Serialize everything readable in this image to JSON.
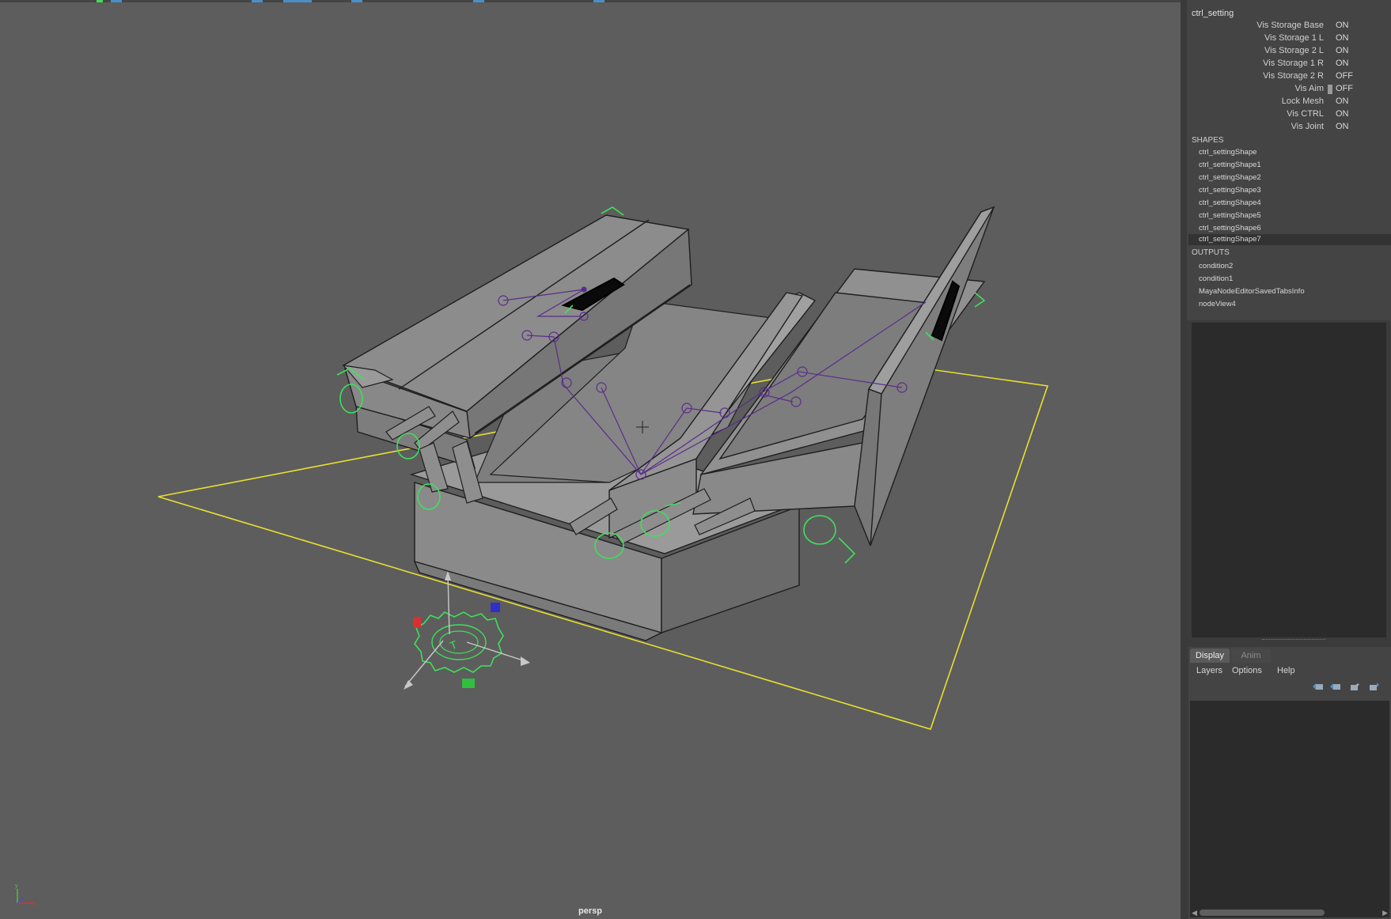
{
  "viewport": {
    "camera_label": "persp"
  },
  "channel_box": {
    "node_name": "ctrl_setting",
    "attributes": [
      {
        "label": "Vis Storage Base",
        "value": "ON"
      },
      {
        "label": "Vis Storage 1 L",
        "value": "ON"
      },
      {
        "label": "Vis Storage 2 L",
        "value": "ON"
      },
      {
        "label": "Vis Storage 1 R",
        "value": "ON"
      },
      {
        "label": "Vis Storage 2 R",
        "value": "OFF"
      },
      {
        "label": "Vis Aim",
        "value": "OFF"
      },
      {
        "label": "Lock Mesh",
        "value": "ON"
      },
      {
        "label": "Vis CTRL",
        "value": "ON"
      },
      {
        "label": "Vis Joint",
        "value": "ON"
      }
    ],
    "shapes_header": "SHAPES",
    "shapes": [
      "ctrl_settingShape",
      "ctrl_settingShape1",
      "ctrl_settingShape2",
      "ctrl_settingShape3",
      "ctrl_settingShape4",
      "ctrl_settingShape5",
      "ctrl_settingShape6",
      "ctrl_settingShape7"
    ],
    "selected_shape": "ctrl_settingShape7",
    "outputs_header": "OUTPUTS",
    "outputs": [
      "condition2",
      "condition1",
      "MayaNodeEditorSavedTabsInfo",
      "nodeView4"
    ]
  },
  "layer_editor": {
    "tabs": [
      "Display",
      "Anim"
    ],
    "active_tab": "Display",
    "menu": [
      "Layers",
      "Options",
      "Help"
    ]
  },
  "colors": {
    "viewport_bg": "#5d5d5d",
    "wire_green": "#3ee05a",
    "ground_yellow": "#e8e030",
    "joint_purple": "#5a2d8a"
  }
}
